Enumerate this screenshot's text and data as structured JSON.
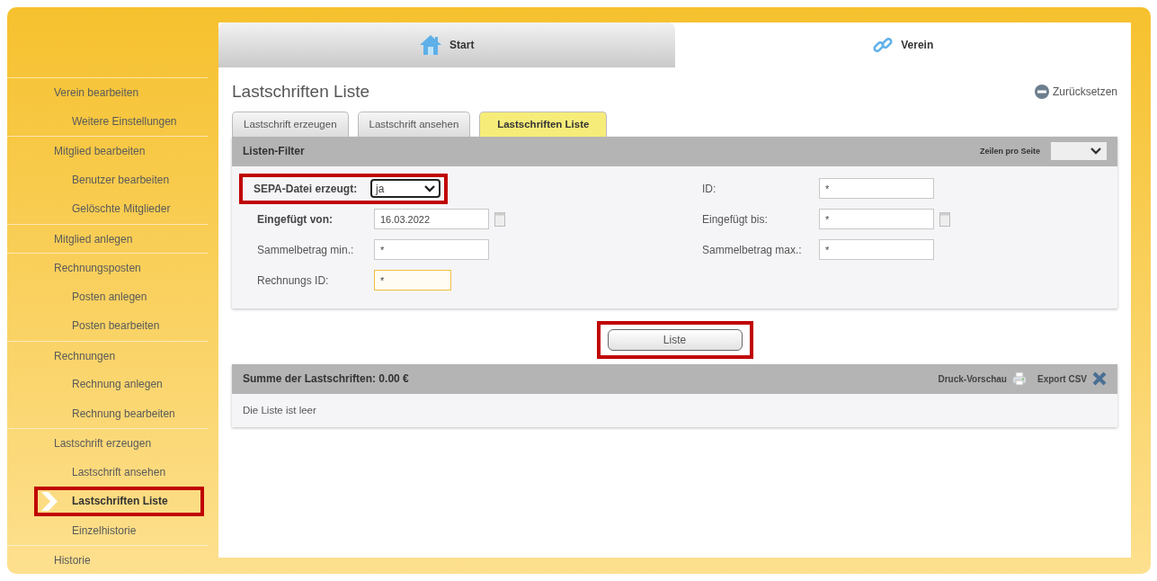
{
  "top_tabs": [
    {
      "label": "Start",
      "selected": false
    },
    {
      "label": "Verein",
      "selected": true
    }
  ],
  "sidebar": {
    "items": [
      {
        "label": "Verein bearbeiten",
        "selected": false,
        "highlighted": false,
        "children": [
          {
            "label": "Weitere Einstellungen",
            "selected": false,
            "highlighted": false
          }
        ]
      },
      {
        "label": "Mitglied bearbeiten",
        "selected": false,
        "highlighted": false,
        "children": [
          {
            "label": "Benutzer bearbeiten",
            "selected": false,
            "highlighted": false
          },
          {
            "label": "Gelöschte Mitglieder",
            "selected": false,
            "highlighted": false
          }
        ]
      },
      {
        "label": "Mitglied anlegen",
        "selected": false,
        "highlighted": false
      },
      {
        "label": "Rechnungsposten",
        "selected": false,
        "highlighted": false,
        "children": [
          {
            "label": "Posten anlegen",
            "selected": false,
            "highlighted": false
          },
          {
            "label": "Posten bearbeiten",
            "selected": false,
            "highlighted": false
          }
        ]
      },
      {
        "label": "Rechnungen",
        "selected": false,
        "highlighted": false,
        "children": [
          {
            "label": "Rechnung anlegen",
            "selected": false,
            "highlighted": false
          },
          {
            "label": "Rechnung bearbeiten",
            "selected": false,
            "highlighted": false
          }
        ]
      },
      {
        "label": "Lastschrift erzeugen",
        "selected": false,
        "highlighted": false,
        "children": [
          {
            "label": "Lastschrift ansehen",
            "selected": false,
            "highlighted": false
          },
          {
            "label": "Lastschriften Liste",
            "selected": true,
            "highlighted": true
          },
          {
            "label": "Einzelhistorie",
            "selected": false,
            "highlighted": false
          }
        ]
      },
      {
        "label": "Historie",
        "selected": false,
        "highlighted": false
      }
    ]
  },
  "page_title": "Lastschriften Liste",
  "reset_link": "Zurücksetzen",
  "sub_tabs": [
    {
      "label": "Lastschrift erzeugen",
      "selected": false
    },
    {
      "label": "Lastschrift ansehen",
      "selected": false
    },
    {
      "label": "Lastschriften Liste",
      "selected": true
    }
  ],
  "filter": {
    "title": "Listen-Filter",
    "rows_per_page_label": "Zeilen pro Seite",
    "fields": [
      {
        "kind": "select",
        "label": "SEPA-Datei erzeugt:",
        "value": "ja",
        "emphasized": true,
        "focused": false,
        "highlighted": true
      },
      {
        "kind": "text",
        "label": "ID:",
        "value": "*",
        "emphasized": false,
        "focused": false,
        "highlighted": false
      },
      {
        "kind": "date",
        "label": "Eingefügt von:",
        "value": "16.03.2022",
        "emphasized": true,
        "focused": false,
        "highlighted": false
      },
      {
        "kind": "date",
        "label": "Eingefügt bis:",
        "value": "*",
        "emphasized": false,
        "focused": false,
        "highlighted": false
      },
      {
        "kind": "text",
        "label": "Sammelbetrag min.:",
        "value": "*",
        "emphasized": false,
        "focused": false,
        "highlighted": false
      },
      {
        "kind": "text",
        "label": "Sammelbetrag max.:",
        "value": "*",
        "emphasized": false,
        "focused": false,
        "highlighted": false
      },
      {
        "kind": "text",
        "label": "Rechnungs ID:",
        "value": "*",
        "emphasized": false,
        "focused": true,
        "highlighted": false
      }
    ]
  },
  "list_button": {
    "label": "Liste",
    "highlighted": true
  },
  "results": {
    "summary": "Summe der Lastschriften: 0.00 €",
    "print_preview": "Druck-Vorschau",
    "export": "Export CSV",
    "empty_message": "Die Liste ist leer"
  }
}
